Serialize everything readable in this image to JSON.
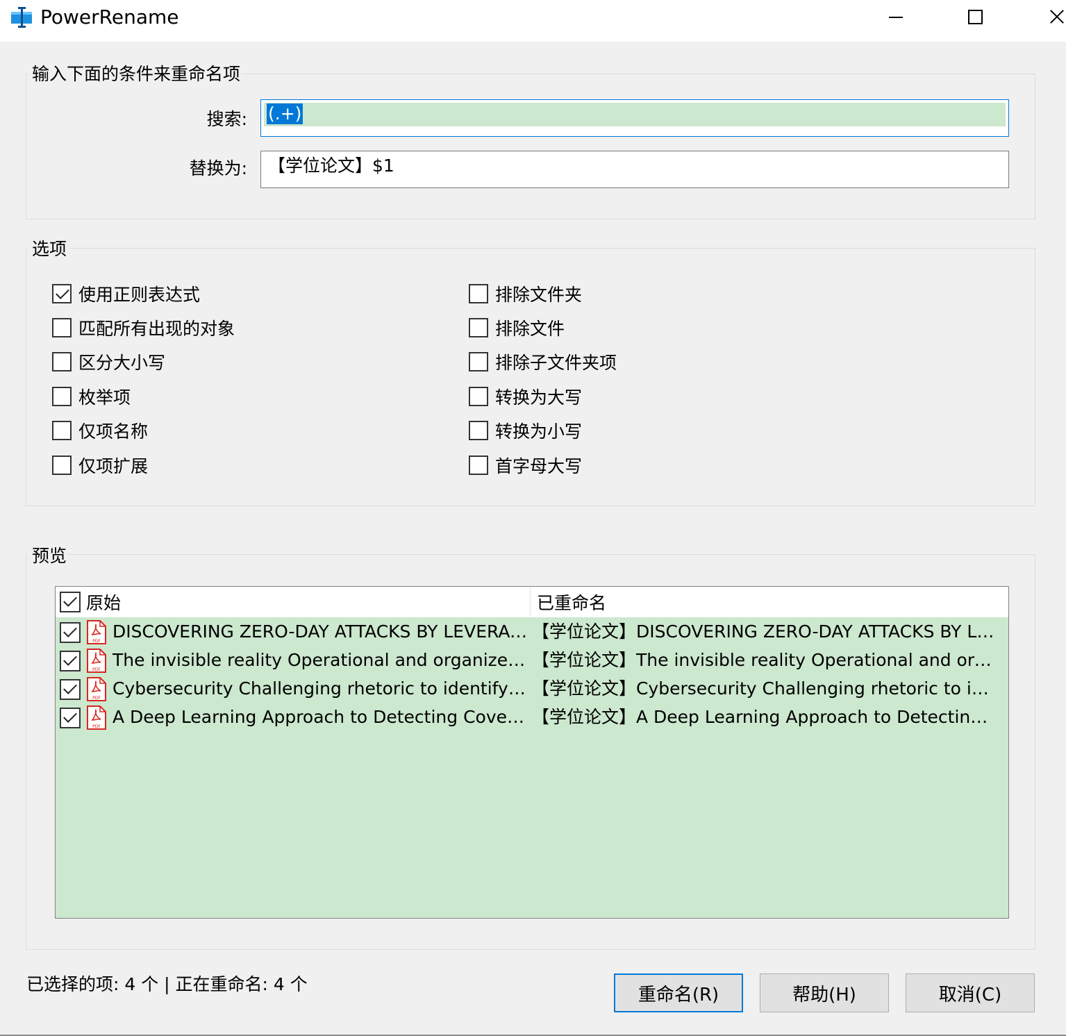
{
  "window": {
    "title": "PowerRename"
  },
  "criteria": {
    "legend": "输入下面的条件来重命名项",
    "search_label": "搜索:",
    "search_value": "(.+)",
    "replace_label": "替换为:",
    "replace_value": "【学位论文】$1"
  },
  "options": {
    "legend": "选项",
    "left": [
      {
        "label": "使用正则表达式",
        "checked": true
      },
      {
        "label": "匹配所有出现的对象",
        "checked": false
      },
      {
        "label": "区分大小写",
        "checked": false
      },
      {
        "label": "枚举项",
        "checked": false
      },
      {
        "label": "仅项名称",
        "checked": false
      },
      {
        "label": "仅项扩展",
        "checked": false
      }
    ],
    "right": [
      {
        "label": "排除文件夹",
        "checked": false
      },
      {
        "label": "排除文件",
        "checked": false
      },
      {
        "label": "排除子文件夹项",
        "checked": false
      },
      {
        "label": "转换为大写",
        "checked": false
      },
      {
        "label": "转换为小写",
        "checked": false
      },
      {
        "label": "首字母大写",
        "checked": false
      }
    ]
  },
  "preview": {
    "legend": "预览",
    "col_original": "原始",
    "col_renamed": "已重命名",
    "rows": [
      {
        "original": "DISCOVERING ZERO-DAY ATTACKS BY LEVERAGING TOPOLOGICAL DATA ANALYSIS",
        "renamed": "【学位论文】DISCOVERING ZERO-DAY ATTACKS BY LEVERAGING TOPOLOGICAL DATA ANALYSIS",
        "checked": true
      },
      {
        "original": "The invisible reality Operational and organized crime",
        "renamed": "【学位论文】The invisible reality Operational and organized crime",
        "checked": true
      },
      {
        "original": "Cybersecurity Challenging rhetoric to identify the threat",
        "renamed": "【学位论文】Cybersecurity Challenging rhetoric to identify the threat",
        "checked": true
      },
      {
        "original": "A Deep Learning Approach to Detecting Covert Channels",
        "renamed": "【学位论文】A Deep Learning Approach to Detecting Covert Channels",
        "checked": true
      }
    ],
    "file_icon": "pdf-file-icon"
  },
  "status": {
    "text": "已选择的项: 4 个 | 正在重命名: 4 个"
  },
  "buttons": {
    "rename": "重命名(R)",
    "help": "帮助(H)",
    "cancel": "取消(C)"
  },
  "colors": {
    "accent": "#0078d7",
    "highlight": "#cce8cf",
    "pdf_red": "#d7261e"
  }
}
